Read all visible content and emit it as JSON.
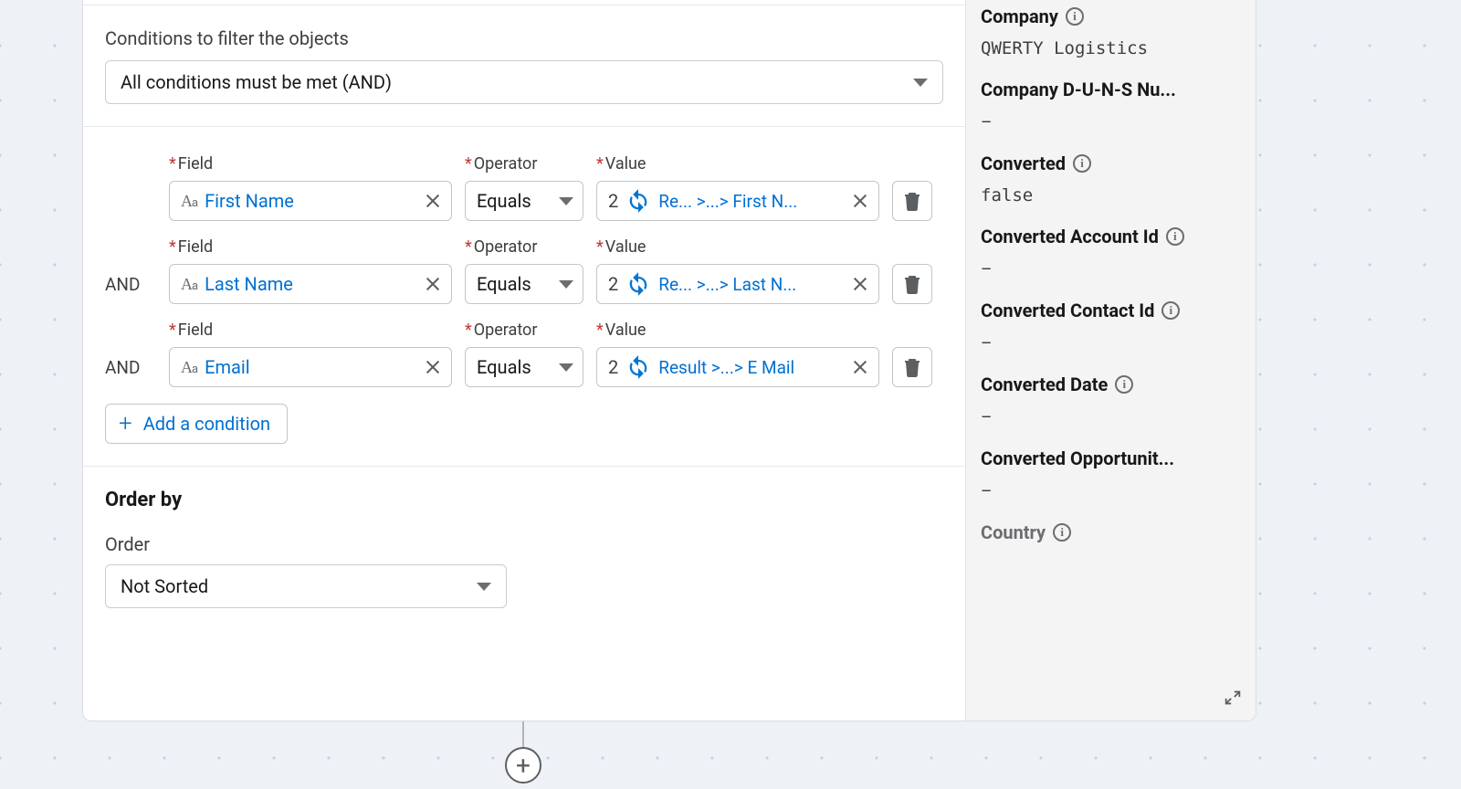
{
  "filter": {
    "heading": "Conditions to filter the objects",
    "logic": "All conditions must be met (AND)",
    "labels": {
      "field": "Field",
      "operator": "Operator",
      "value": "Value",
      "and": "AND"
    },
    "rows": [
      {
        "field": "First Name",
        "operator": "Equals",
        "value_num": "2",
        "value_path": "Re...  >...> First N..."
      },
      {
        "field": "Last Name",
        "operator": "Equals",
        "value_num": "2",
        "value_path": "Re...  >...> Last N..."
      },
      {
        "field": "Email",
        "operator": "Equals",
        "value_num": "2",
        "value_path": "Result >...> E Mail"
      }
    ],
    "add_label": "Add a condition"
  },
  "orderby": {
    "heading": "Order by",
    "label": "Order",
    "value": "Not Sorted"
  },
  "side": [
    {
      "label": "Company",
      "info": true,
      "value": "QWERTY Logistics",
      "mono": true
    },
    {
      "label": "Company D-U-N-S Nu...",
      "info": false,
      "value": "–"
    },
    {
      "label": "Converted",
      "info": true,
      "value": "false",
      "mono": true
    },
    {
      "label": "Converted Account Id",
      "info": true,
      "value": "–"
    },
    {
      "label": "Converted Contact Id",
      "info": true,
      "value": "–"
    },
    {
      "label": "Converted Date",
      "info": true,
      "value": "–"
    },
    {
      "label": "Converted Opportunit...",
      "info": false,
      "value": "–"
    },
    {
      "label": "Country",
      "info": true,
      "value": "",
      "dim": true
    }
  ]
}
